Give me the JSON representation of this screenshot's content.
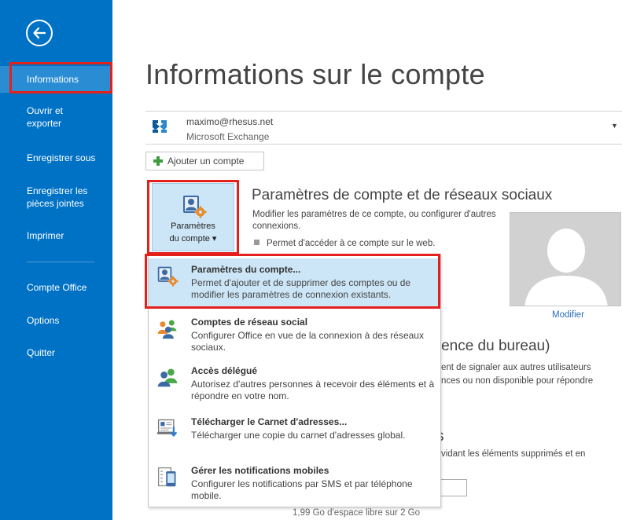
{
  "sidebar": {
    "items": [
      {
        "label": "Informations"
      },
      {
        "label": "Ouvrir et\nexporter"
      },
      {
        "label": "Enregistrer sous"
      },
      {
        "label": "Enregistrer les\npièces jointes"
      },
      {
        "label": "Imprimer"
      },
      {
        "label": "Compte Office"
      },
      {
        "label": "Options"
      },
      {
        "label": "Quitter"
      }
    ]
  },
  "page_title": "Informations sur le compte",
  "account": {
    "email": "maximo@rhesus.net",
    "type": "Microsoft Exchange"
  },
  "add_account_label": "Ajouter un compte",
  "account_settings_button": {
    "line1": "Paramètres",
    "line2": "du compte ▾"
  },
  "section": {
    "title": "Paramètres de compte et de réseaux sociaux",
    "desc": "Modifier les paramètres de ce compte, ou configurer d'autres connexions.",
    "bullet": "Permet d'accéder à ce compte sur le web."
  },
  "modify_link": "Modifier",
  "background": {
    "title2": "bsence du bureau)",
    "line1": "ent de signaler aux autres utilisateurs",
    "line2": "nces ou non disponible pour répondre",
    "title3": "s",
    "line3": "vidant les éléments supprimés et en",
    "line4": "1,99 Go d'espace libre sur 2 Go"
  },
  "menu": {
    "items": [
      {
        "title": "Paramètres du compte...",
        "desc": "Permet d'ajouter et de supprimer des comptes ou de modifier les paramètres de connexion existants.",
        "icon": "account-settings-icon"
      },
      {
        "title": "Comptes de réseau social",
        "desc": "Configurer Office en vue de la connexion à des réseaux sociaux.",
        "icon": "social-network-icon"
      },
      {
        "title": "Accès délégué",
        "desc": "Autorisez d'autres personnes à recevoir des éléments et à répondre en votre nom.",
        "icon": "delegate-access-icon"
      },
      {
        "title": "Télécharger le Carnet d'adresses...",
        "desc": "Télécharger une copie du carnet d'adresses global.",
        "icon": "download-address-book-icon"
      },
      {
        "title": "Gérer les notifications mobiles",
        "desc": "Configurer les notifications par SMS et par téléphone mobile.",
        "icon": "mobile-notifications-icon"
      }
    ]
  },
  "colors": {
    "sidebar": "#0072c6",
    "highlight": "#cde6f7",
    "annotation_red": "#e3201b",
    "link": "#2a6ebb"
  }
}
